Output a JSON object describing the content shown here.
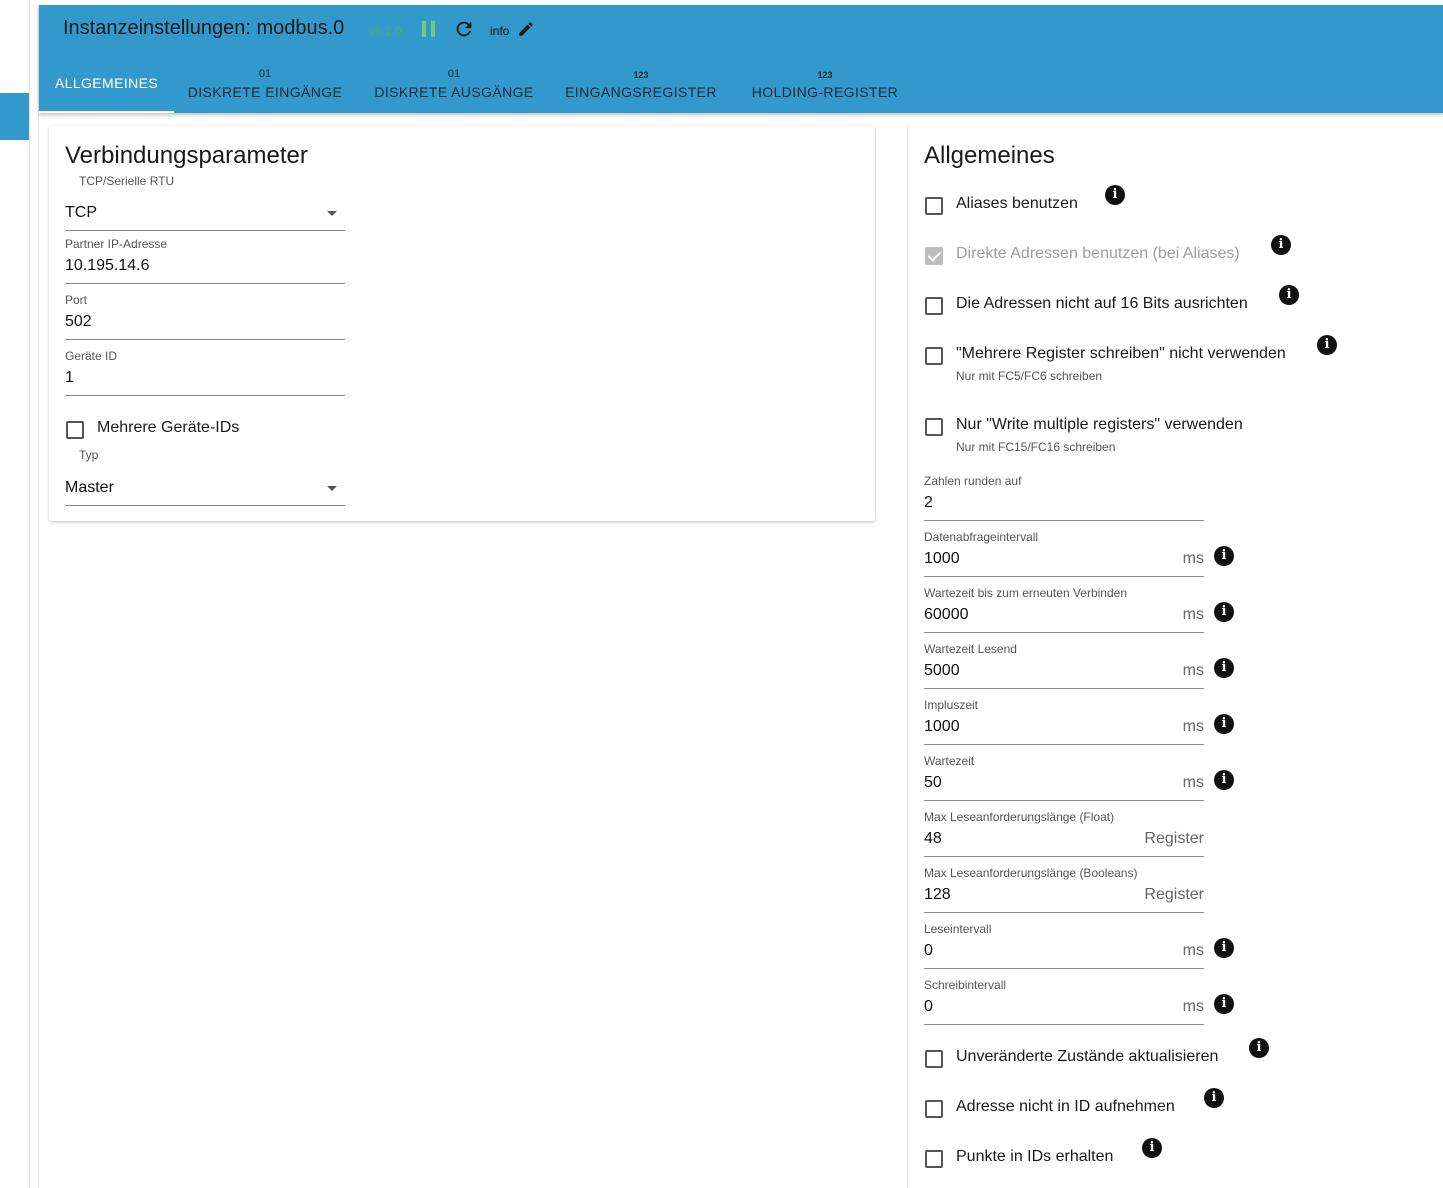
{
  "header": {
    "title": "Instanzeinstellungen: modbus.0",
    "version": "v6.1.0",
    "info_label": "info",
    "icons": [
      "pause-icon",
      "refresh-icon",
      "edit-icon"
    ]
  },
  "tabs": [
    {
      "badge": "",
      "label": "ALLGEMEINES"
    },
    {
      "badge": "01",
      "label": "DISKRETE EINGÄNGE"
    },
    {
      "badge": "01",
      "label": "DISKRETE AUSGÄNGE"
    },
    {
      "badge": "123",
      "label": "EINGANGSREGISTER"
    },
    {
      "badge": "123",
      "label": "HOLDING-REGISTER"
    }
  ],
  "connection": {
    "title": "Verbindungsparameter",
    "mode_label": "TCP/Serielle RTU",
    "mode_value": "TCP",
    "ip_label": "Partner IP-Adresse",
    "ip_value": "10.195.14.6",
    "port_label": "Port",
    "port_value": "502",
    "device_label": "Geräte ID",
    "device_value": "1",
    "multi_ids_label": "Mehrere Geräte-IDs",
    "type_label": "Typ",
    "type_value": "Master"
  },
  "general": {
    "title": "Allgemeines",
    "checkboxes": [
      {
        "label": "Aliases benutzen",
        "checked": false
      },
      {
        "label": "Direkte Adressen benutzen (bei Aliases)",
        "checked": true
      },
      {
        "label": "Die Adressen nicht auf 16 Bits ausrichten",
        "checked": false
      },
      {
        "label": "\"Mehrere Register schreiben\" nicht verwenden",
        "sub": "Nur mit FC5/FC6 schreiben",
        "checked": false
      },
      {
        "label": "Nur \"Write multiple registers\" verwenden",
        "sub": "Nur mit FC15/FC16 schreiben",
        "checked": false
      }
    ],
    "fields": [
      {
        "label": "Zahlen runden auf",
        "value": "2",
        "unit": ""
      },
      {
        "label": "Datenabfrageintervall",
        "value": "1000",
        "unit": "ms"
      },
      {
        "label": "Wartezeit bis zum erneuten Verbinden",
        "value": "60000",
        "unit": "ms"
      },
      {
        "label": "Wartezeit Lesend",
        "value": "5000",
        "unit": "ms"
      },
      {
        "label": "Impluszeit",
        "value": "1000",
        "unit": "ms"
      },
      {
        "label": "Wartezeit",
        "value": "50",
        "unit": "ms"
      },
      {
        "label": "Max Leseanforderungslänge (Float)",
        "value": "48",
        "unit": "Register"
      },
      {
        "label": "Max Leseanforderungslänge (Booleans)",
        "value": "128",
        "unit": "Register"
      },
      {
        "label": "Leseintervall",
        "value": "0",
        "unit": "ms"
      },
      {
        "label": "Schreibintervall",
        "value": "0",
        "unit": "ms"
      }
    ],
    "bottom_checkboxes": [
      {
        "label": "Unveränderte Zustände aktualisieren",
        "checked": false
      },
      {
        "label": "Adresse nicht in ID aufnehmen",
        "checked": false
      },
      {
        "label": "Punkte in IDs erhalten",
        "checked": false
      }
    ],
    "info_glyph": "i"
  },
  "colors": {
    "accent": "#3399cc",
    "version": "#4caf50",
    "pause": "#6fd06f"
  }
}
